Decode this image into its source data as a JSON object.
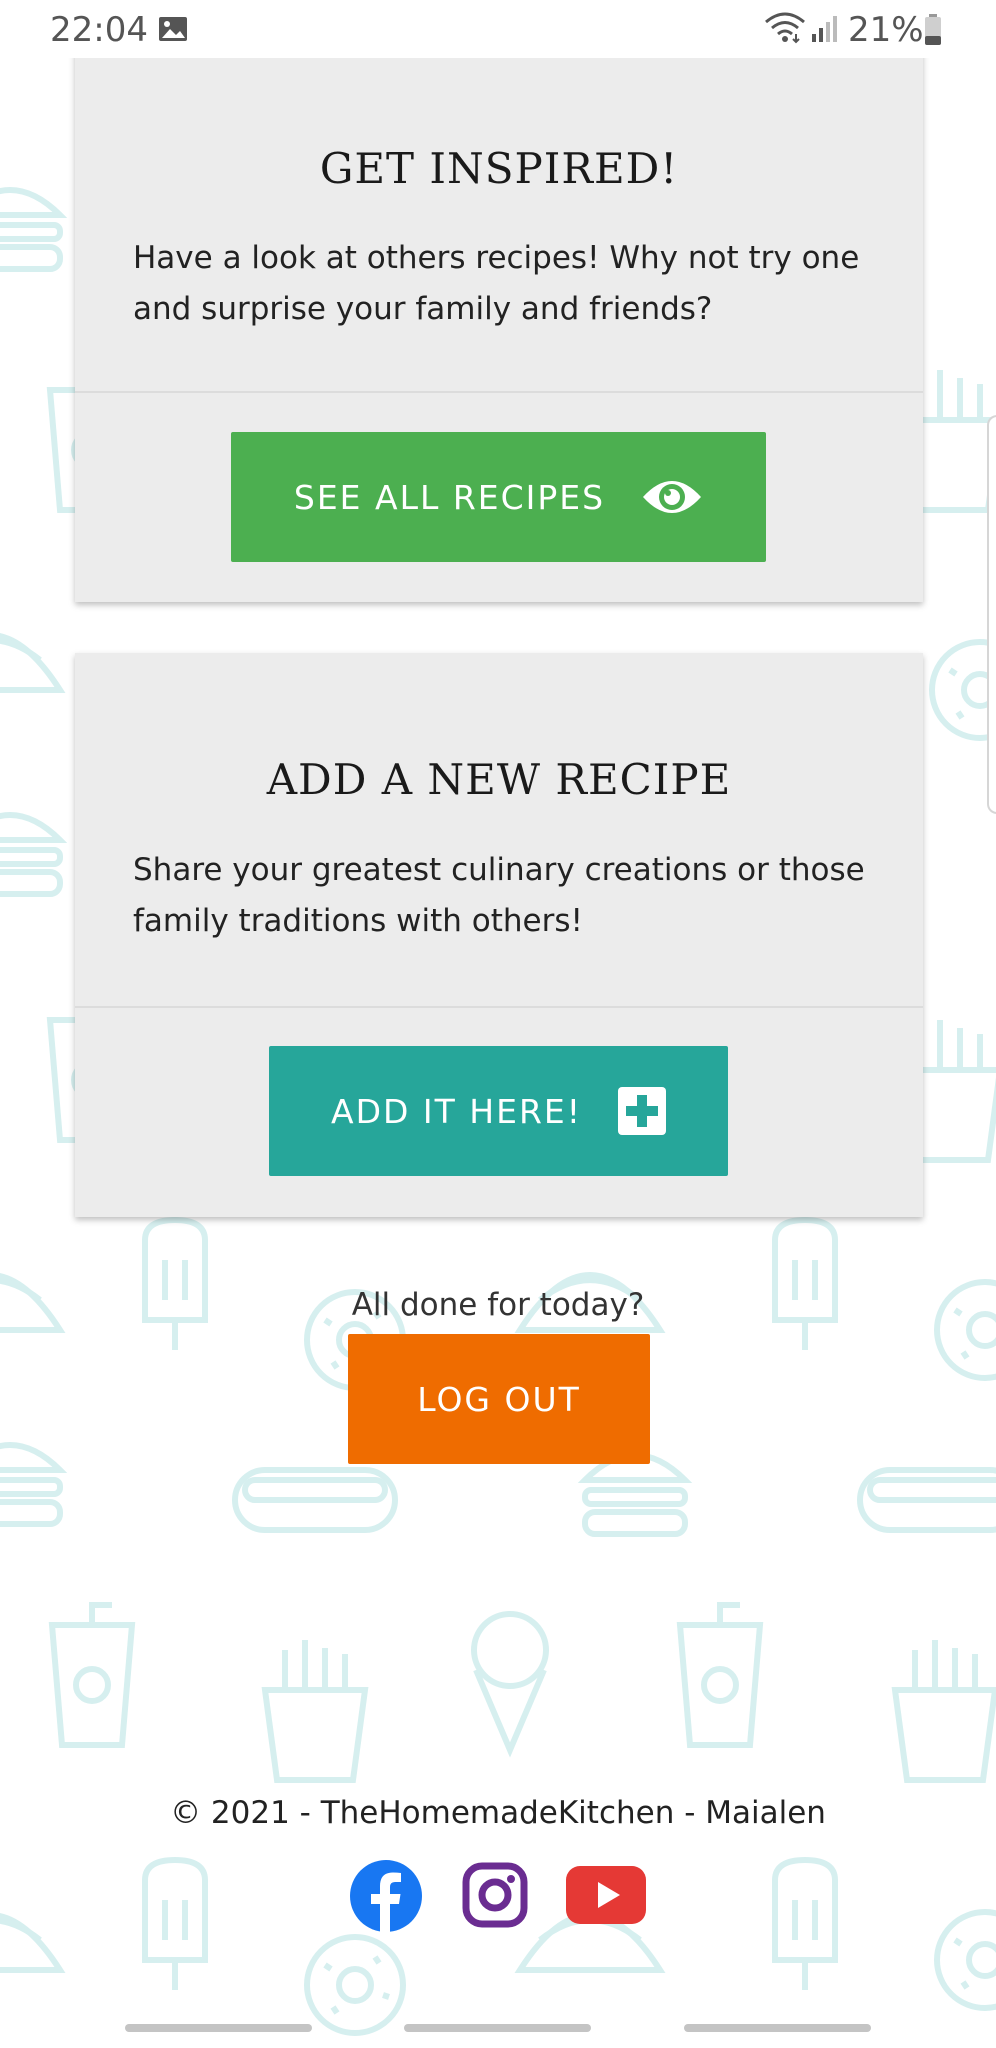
{
  "status_bar": {
    "time": "22:04",
    "battery": "21%",
    "icons": [
      "image-icon",
      "wifi-icon",
      "signal-icon",
      "battery-icon"
    ]
  },
  "cards": {
    "inspire": {
      "title": "GET INSPIRED!",
      "text": "Have a look at others recipes! Why not try one and surprise your family and friends?",
      "button_label": "SEE ALL RECIPES",
      "button_icon": "eye-icon",
      "button_color": "#4caf50"
    },
    "add": {
      "title": "ADD A NEW RECIPE",
      "text": "Share your greatest culinary creations or those family traditions with others!",
      "button_label": "ADD IT HERE!",
      "button_icon": "plus-square-icon",
      "button_color": "#26a69a"
    }
  },
  "logout": {
    "question": "All done for today?",
    "button_label": "LOG OUT",
    "button_color": "#ef6c00"
  },
  "footer": {
    "copyright": "© 2021 - TheHomemadeKitchen - Maialen",
    "social": [
      "facebook-icon",
      "instagram-icon",
      "youtube-icon"
    ]
  },
  "colors": {
    "card_bg": "#ececec",
    "pattern": "#d8f1f1",
    "facebook": "#1877f2",
    "instagram": "#6a2c91",
    "youtube": "#e53935"
  }
}
